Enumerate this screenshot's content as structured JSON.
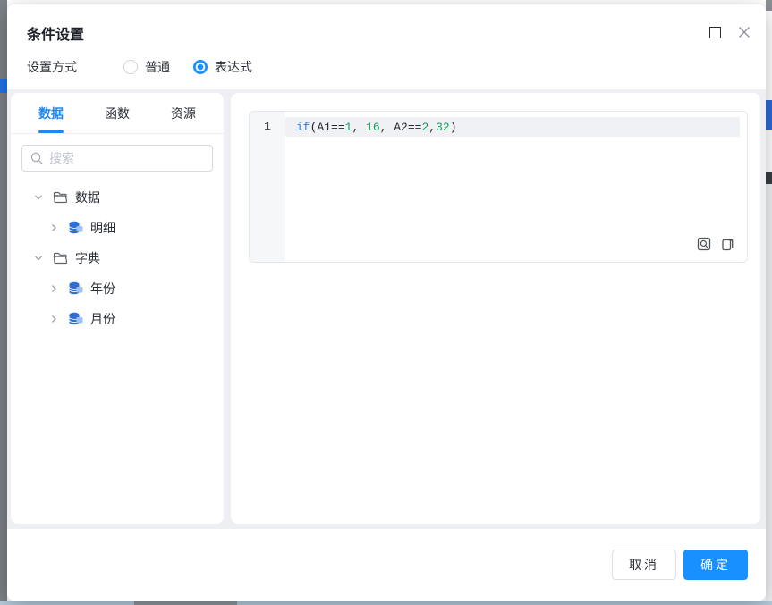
{
  "dialog": {
    "title": "条件设置"
  },
  "settings": {
    "label": "设置方式",
    "options": [
      {
        "label": "普通",
        "selected": false
      },
      {
        "label": "表达式",
        "selected": true
      }
    ]
  },
  "sidebar": {
    "tabs": [
      {
        "label": "数据",
        "active": true
      },
      {
        "label": "函数",
        "active": false
      },
      {
        "label": "资源",
        "active": false
      }
    ],
    "search": {
      "placeholder": "搜索",
      "value": ""
    },
    "tree": [
      {
        "label": "数据",
        "type": "folder",
        "level": 1,
        "expanded": true
      },
      {
        "label": "明细",
        "type": "database",
        "level": 2,
        "expanded": false
      },
      {
        "label": "字典",
        "type": "folder",
        "level": 1,
        "expanded": true
      },
      {
        "label": "年份",
        "type": "database",
        "level": 2,
        "expanded": false
      },
      {
        "label": "月份",
        "type": "database",
        "level": 2,
        "expanded": false
      }
    ]
  },
  "editor": {
    "line_number": "1",
    "code": "if(A1==1, 16, A2==2,32)",
    "tokens": [
      {
        "t": "if"
      },
      {
        "t": "(A1=="
      },
      {
        "t": "1"
      },
      {
        "t": ", "
      },
      {
        "t": "16"
      },
      {
        "t": ", A2=="
      },
      {
        "t": "2"
      },
      {
        "t": ","
      },
      {
        "t": "32"
      },
      {
        "t": ")"
      }
    ]
  },
  "footer": {
    "cancel_label": "取消",
    "ok_label": "确定"
  },
  "icons": {
    "maximize": "maximize-icon",
    "close": "close-icon",
    "search": "search-icon",
    "preview": "preview-zoom-icon",
    "copy": "copy-icon"
  },
  "colors": {
    "accent": "#1890ff",
    "tab_active": "#1f87f5",
    "code_keyword": "#2d7ce5",
    "code_number": "#17a15e",
    "body_bg": "#edeff3"
  }
}
